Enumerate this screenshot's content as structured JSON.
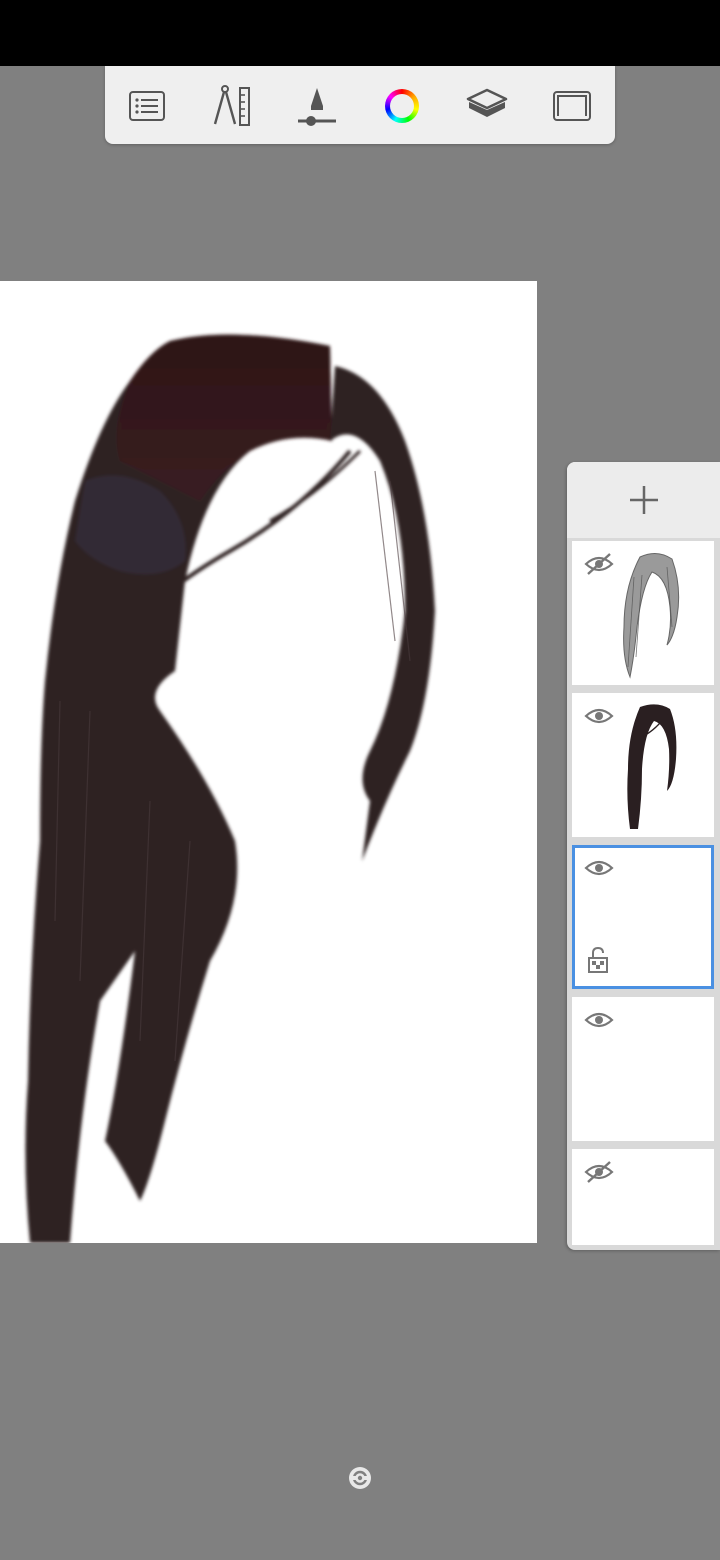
{
  "toolbar": {
    "tools": [
      {
        "name": "menu",
        "icon": "list-icon"
      },
      {
        "name": "ruler",
        "icon": "compass-ruler-icon"
      },
      {
        "name": "brush",
        "icon": "brush-properties-icon"
      },
      {
        "name": "color",
        "icon": "color-wheel-icon"
      },
      {
        "name": "layers",
        "icon": "layers-icon"
      },
      {
        "name": "fullscreen",
        "icon": "fullscreen-icon"
      }
    ]
  },
  "layers_panel": {
    "add_icon": "plus-icon",
    "layers": [
      {
        "visible": false,
        "thumbnail": "grey-hair-sketch",
        "selected": false,
        "lock_icon": false
      },
      {
        "visible": true,
        "thumbnail": "dark-hair",
        "selected": false,
        "lock_icon": false
      },
      {
        "visible": true,
        "thumbnail": "empty",
        "selected": true,
        "lock_icon": true
      },
      {
        "visible": true,
        "thumbnail": "empty",
        "selected": false,
        "lock_icon": false
      },
      {
        "visible": false,
        "thumbnail": "empty",
        "selected": false,
        "lock_icon": false
      }
    ]
  },
  "colors": {
    "background": "#808080",
    "toolbar": "#efefef",
    "selection": "#4a90e2",
    "hair": "#2e2223"
  }
}
